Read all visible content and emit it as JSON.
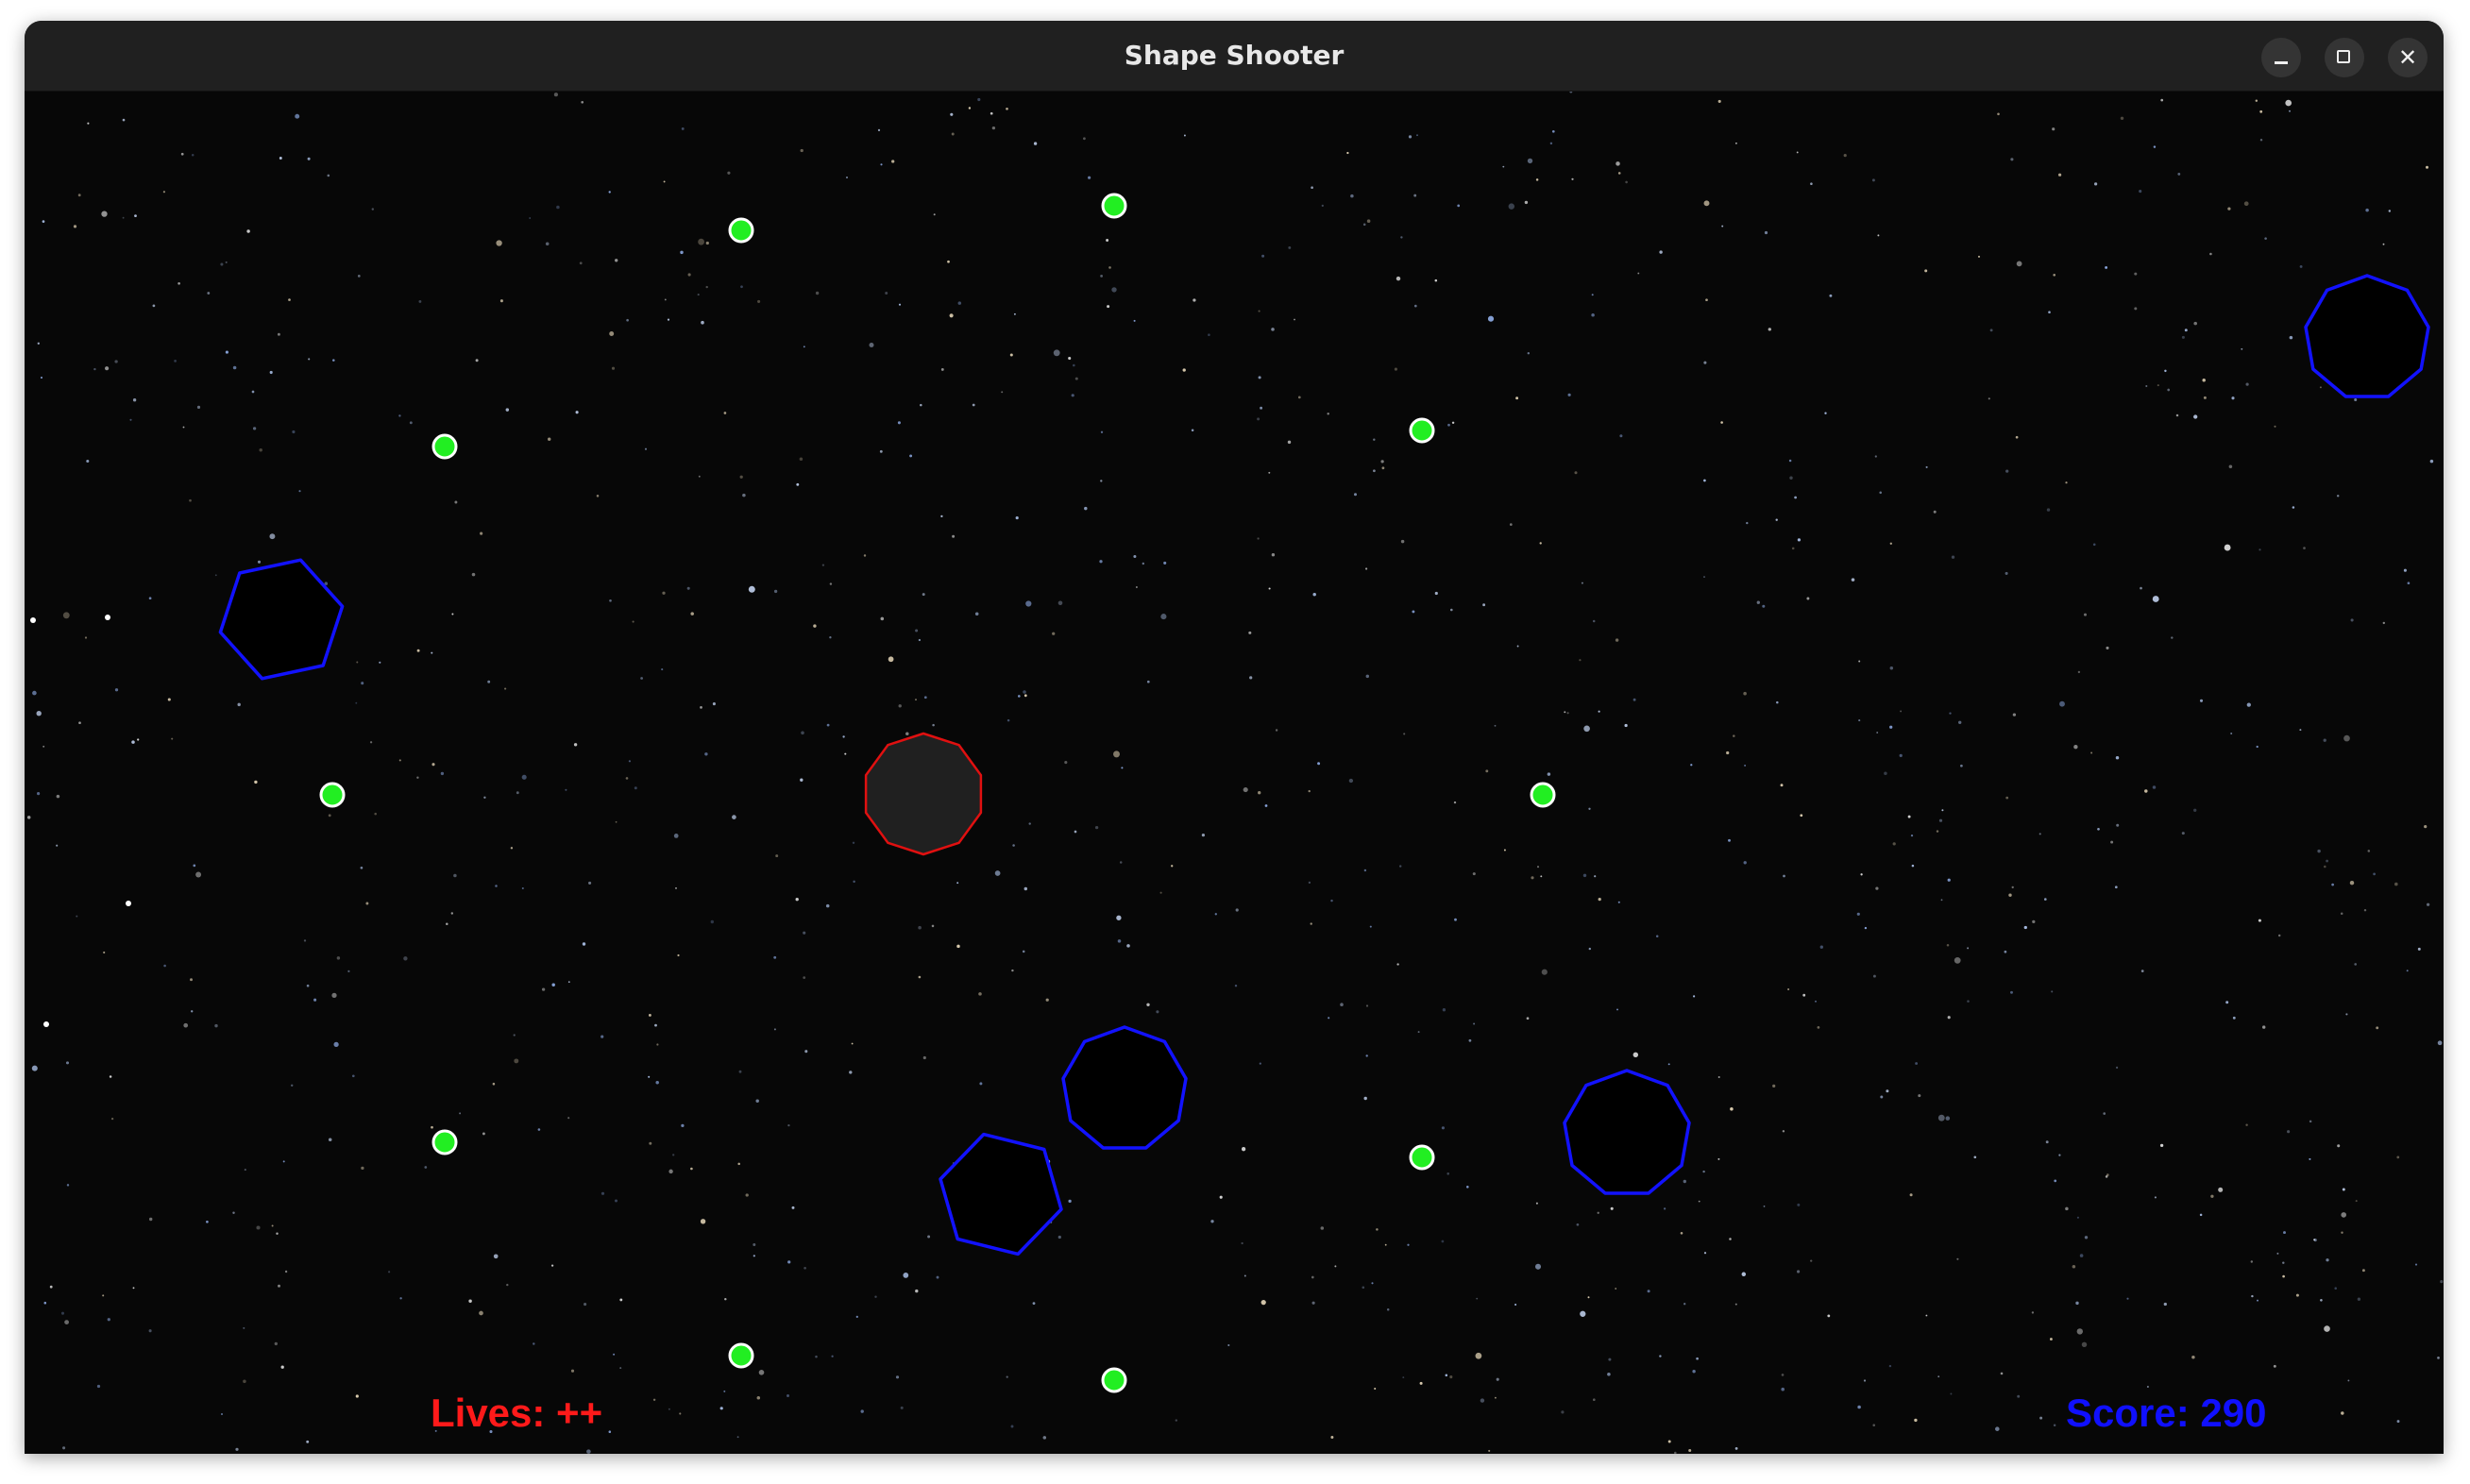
{
  "window": {
    "title": "Shape Shooter",
    "controls": {
      "minimize_glyph": "–",
      "maximize_glyph": "□",
      "close_glyph": "✕"
    }
  },
  "hud": {
    "lives_text": "Lives: ++",
    "score_text": "Score: 290"
  },
  "colors": {
    "background": "#070707",
    "enemy_outline": "#1212ff",
    "player_outline": "#e01010",
    "player_fill": "#202020",
    "bullet_fill": "#22ee22",
    "bullet_outline": "#ffffff",
    "lives_text": "#ff1a1a",
    "score_text": "#1010ff"
  },
  "icons": {
    "player": "decagon-ship",
    "enemy": "polygon-enemy",
    "projectile": "green-orb"
  }
}
